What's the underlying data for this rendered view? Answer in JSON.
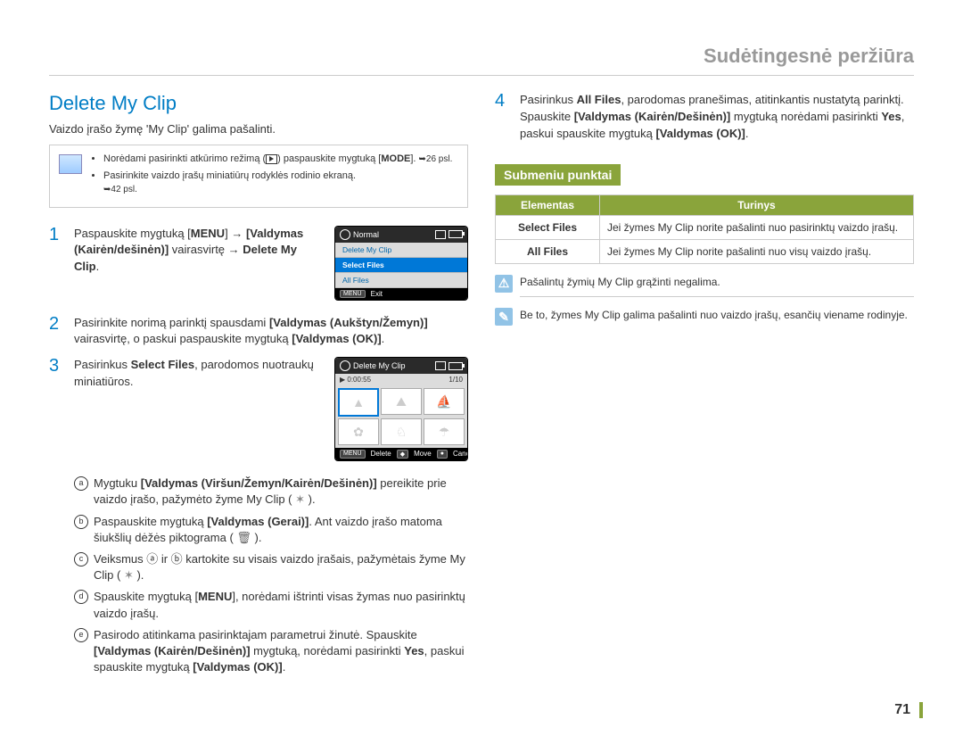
{
  "header": {
    "title": "Sudėtingesnė peržiūra"
  },
  "left": {
    "title": "Delete My Clip",
    "intro": "Vaizdo įrašo žymę 'My Clip' galima pašalinti.",
    "infobox": {
      "item1_a": "Norėdami pasirinkti atkūrimo režimą (",
      "item1_b": ") paspauskite mygtuką [",
      "item1_c": "MODE",
      "item1_d": "]. ",
      "item1_e": "26 psl.",
      "item2_a": "Pasirinkite vaizdo įrašų miniatiūrų rodyklės rodinio ekraną. ",
      "item2_b": "42 psl."
    },
    "step1": {
      "a": "Paspauskite mygtuką [",
      "b": "MENU",
      "c": "] ",
      "d": "[Valdymas (Kairėn/dešinėn)]",
      "e": " vairasvirtę ",
      "f": "Delete My Clip",
      "g": "."
    },
    "step2": {
      "a": "Pasirinkite norimą parinktį spausdami ",
      "b": "[Valdymas (Aukštyn/Žemyn)]",
      "c": " vairasvirtę, o paskui paspauskite mygtuką ",
      "d": "[Valdymas (OK)]",
      "e": "."
    },
    "step3": {
      "a": "Pasirinkus ",
      "b": "Select Files",
      "c": ", parodomos nuotraukų miniatiūros."
    },
    "sub": {
      "a1": "Mygtuku  ",
      "a2": "[Valdymas (Viršun/Žemyn/Kairėn/Dešinėn)]",
      "a3": " pereikite prie vaizdo įrašo, pažymėto žyme My Clip ( ",
      "a4": " ).",
      "b1": "Paspauskite mygtuką ",
      "b2": "[Valdymas (Gerai)]",
      "b3": ". Ant vaizdo įrašo matoma šiukšlių dėžės piktograma ( ",
      "b4": " ).",
      "c1": "Veiksmus ⓐ ir ⓑ kartokite su visais vaizdo įrašais, pažymėtais žyme My Clip ( ",
      "c2": " ).",
      "d1": "Spauskite mygtuką [",
      "d2": "MENU",
      "d3": "], norėdami ištrinti visas žymas nuo pasirinktų vaizdo įrašų.",
      "e1": "Pasirodo atitinkama pasirinktajam parametrui žinutė. Spauskite ",
      "e2": "[Valdymas (Kairėn/Dešinėn)]",
      "e3": " mygtuką, norėdami pasirinkti ",
      "e4": "Yes",
      "e5": ", paskui spauskite mygtuką ",
      "e6": "[Valdymas (OK)]",
      "e7": "."
    },
    "osd1": {
      "top": "Normal",
      "item1": "Delete My Clip",
      "item2": "Select Files",
      "item3": "All Files",
      "exit": "Exit",
      "menu": "MENU"
    },
    "osd2": {
      "top": "Delete My Clip",
      "time": "0:00:55",
      "count": "1/10",
      "b1": "Delete",
      "b2": "Move",
      "b3": "Cancel",
      "menu": "MENU"
    }
  },
  "right": {
    "step4": {
      "a": "Pasirinkus ",
      "b": "All Files",
      "c": ", parodomas pranešimas, atitinkantis nustatytą parinktį. Spauskite ",
      "d": "[Valdymas (Kairėn/Dešinėn)]",
      "e": " mygtuką norėdami pasirinkti ",
      "f": "Yes",
      "g": ", paskui spauskite mygtuką ",
      "h": "[Valdymas (OK)]",
      "i": "."
    },
    "submenu_title": "Submeniu punktai",
    "table": {
      "h1": "Elementas",
      "h2": "Turinys",
      "r1c1": "Select Files",
      "r1c2": "Jei žymes My Clip norite pašalinti nuo pasirinktų vaizdo įrašų.",
      "r2c1": "All Files",
      "r2c2": "Jei žymes My Clip norite pašalinti nuo visų vaizdo įrašų."
    },
    "note1": "Pašalintų žymių My Clip grąžinti negalima.",
    "note2": "Be to, žymes My Clip galima pašalinti nuo vaizdo įrašų, esančių viename rodinyje."
  },
  "page_number": "71"
}
